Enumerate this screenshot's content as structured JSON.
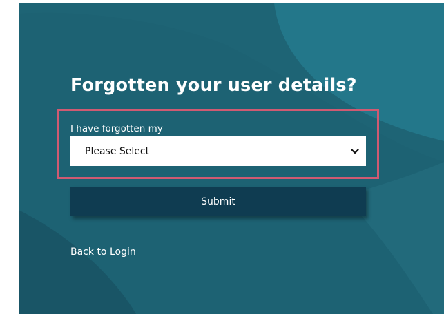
{
  "page": {
    "title": "Forgotten your user details?"
  },
  "form": {
    "field_label": "I have forgotten my",
    "select_value": "Please Select",
    "submit_label": "Submit"
  },
  "links": {
    "back_to_login": "Back to Login"
  },
  "icons": {
    "select_chevron": "chevron-down-icon"
  },
  "colors": {
    "panel_background": "#1d6273",
    "submit_background": "#0f3c51",
    "highlight_border": "#d05a72",
    "text": "#ffffff"
  }
}
